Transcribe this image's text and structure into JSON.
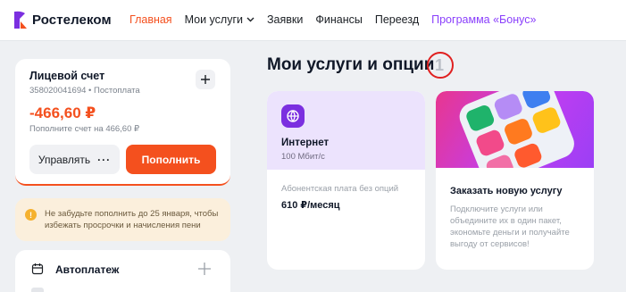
{
  "header": {
    "logo_text": "Ростелеком",
    "nav": [
      {
        "label": "Главная"
      },
      {
        "label": "Мои услуги"
      },
      {
        "label": "Заявки"
      },
      {
        "label": "Финансы"
      },
      {
        "label": "Переезд"
      },
      {
        "label": "Программа «Бонус»"
      }
    ]
  },
  "account": {
    "title": "Лицевой счет",
    "subtitle": "358020041694 • Постоплата",
    "balance": "-466,60 ₽",
    "hint": "Пополните счет на 466,60 ₽",
    "manage_label": "Управлять",
    "manage_dots": "···",
    "pay_label": "Пополнить"
  },
  "notice": {
    "icon_text": "!",
    "text": "Не забудьте пополнить до 25 января, чтобы избежать просрочки и начисления пени"
  },
  "autopay": {
    "label": "Автоплатеж"
  },
  "services": {
    "title": "Мои услуги и опции",
    "count": "1",
    "internet": {
      "name": "Интернет",
      "speed": "100 Мбит/с",
      "fee_label": "Абонентская плата без опций",
      "fee_value": "610 ₽/месяц"
    },
    "order": {
      "title": "Заказать новую услугу",
      "text": "Подключите услуги или объедините их в один пакет, экономьте деньги и получайте выгоду от сервисов!"
    }
  },
  "colors": {
    "accent": "#f4501e",
    "purple": "#7b2fe0",
    "annotation": "#e02020"
  },
  "icons": [
    "rostelecom-logo-icon",
    "chevron-down-icon",
    "plus-icon",
    "info-icon",
    "calendar-icon",
    "globe-icon"
  ]
}
